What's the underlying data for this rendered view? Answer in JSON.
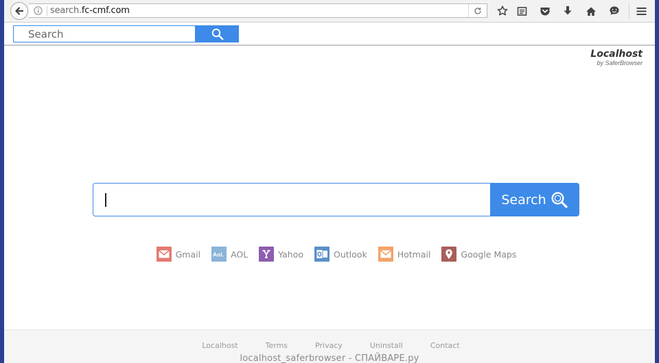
{
  "browser": {
    "url_prefix": "search.",
    "url_domain": "fc-cmf.com",
    "toolbar_icons": [
      "star-icon",
      "reading-list-icon",
      "pocket-icon",
      "download-icon",
      "home-icon",
      "chat-icon",
      "menu-icon"
    ]
  },
  "toolbar_search": {
    "placeholder": "Search"
  },
  "brand": {
    "name": "Localhost",
    "sub": "by SaferBrowser"
  },
  "main_search": {
    "value": "",
    "button_label": "Search"
  },
  "quick_links": [
    {
      "label": "Gmail",
      "icon": "gmail-icon",
      "color": "#e47a70"
    },
    {
      "label": "AOL",
      "icon": "aol-icon",
      "color": "#8ab4d8"
    },
    {
      "label": "Yahoo",
      "icon": "yahoo-icon",
      "color": "#8e5db0"
    },
    {
      "label": "Outlook",
      "icon": "outlook-icon",
      "color": "#5c8fc9"
    },
    {
      "label": "Hotmail",
      "icon": "hotmail-icon",
      "color": "#f2a36a"
    },
    {
      "label": "Google Maps",
      "icon": "google-maps-icon",
      "color": "#a95f5b"
    }
  ],
  "footer": {
    "links": [
      "Localhost",
      "Terms",
      "Privacy",
      "Uninstall",
      "Contact"
    ],
    "watermark": "localhost_saferbrowser - СПАЙВАРЕ.ру"
  },
  "colors": {
    "accent": "#3d8ae8",
    "desktop": "#2d3f93"
  }
}
